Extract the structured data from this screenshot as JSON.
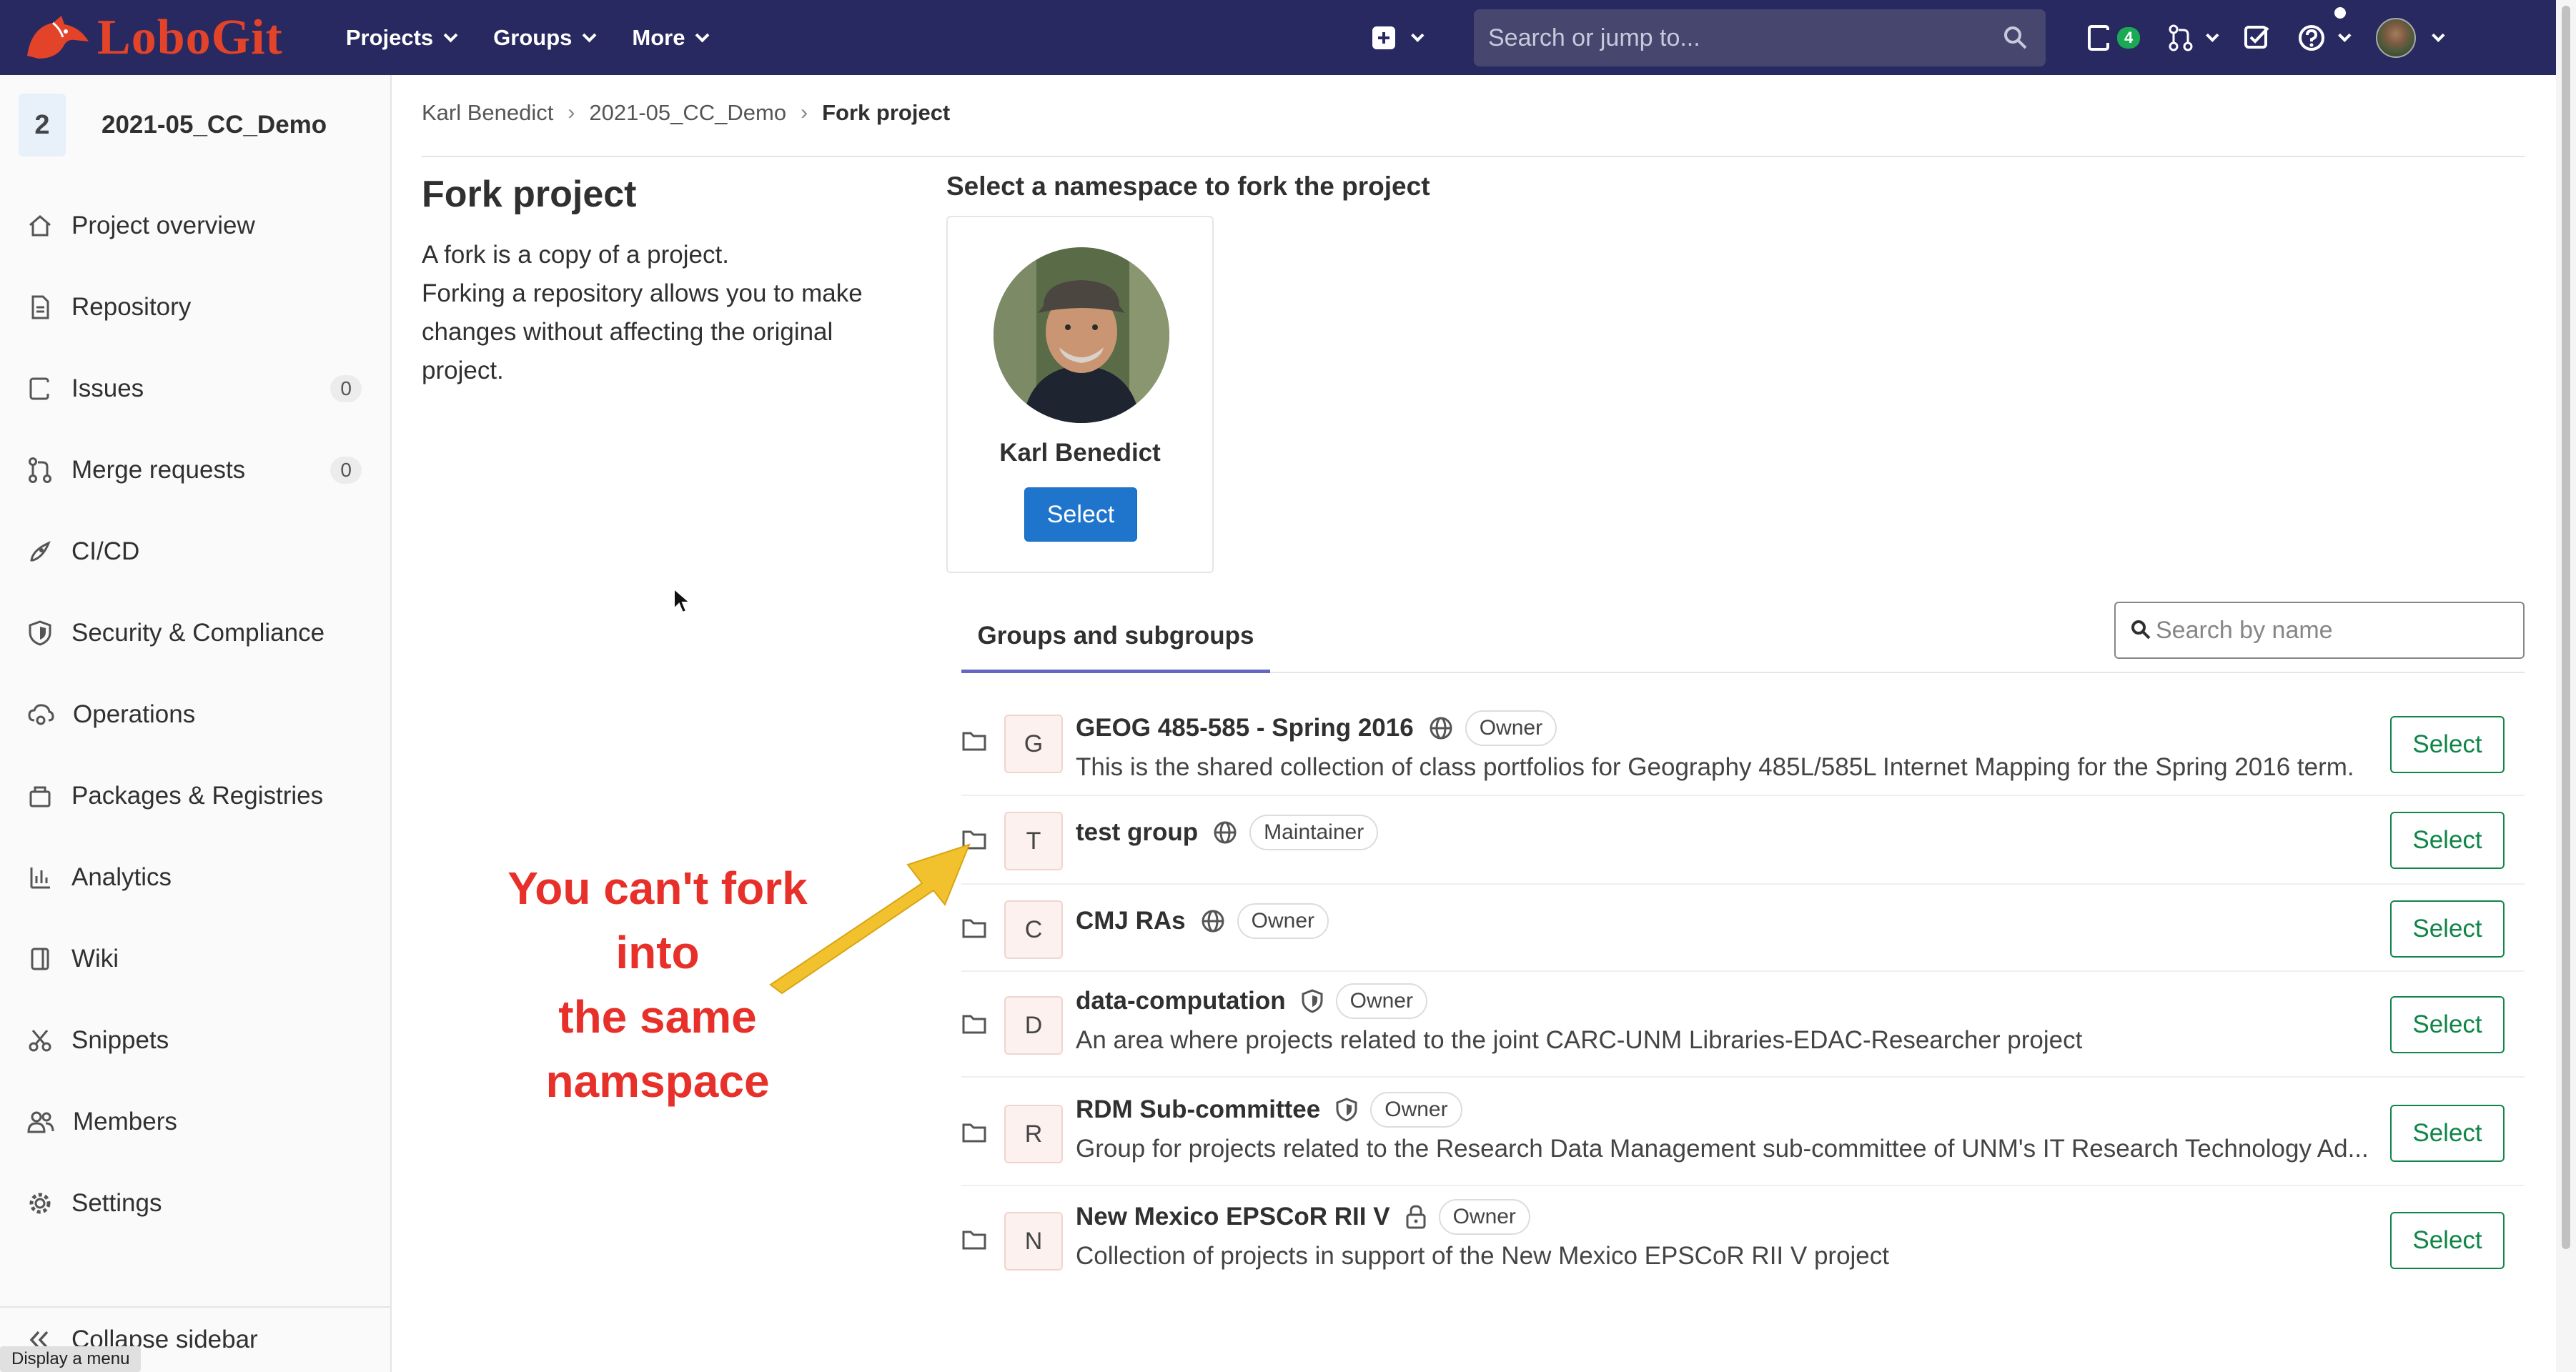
{
  "app": {
    "logo_text": "LoboGit",
    "brand_color": "#292961",
    "logo_color": "#e24329"
  },
  "navbar": {
    "menus": [
      {
        "label": "Projects"
      },
      {
        "label": "Groups"
      },
      {
        "label": "More"
      }
    ],
    "search_placeholder": "Search or jump to...",
    "issues_badge": "4"
  },
  "sidebar": {
    "project_avatar": "2",
    "project_name": "2021-05_CC_Demo",
    "items": [
      {
        "label": "Project overview",
        "icon": "home-icon"
      },
      {
        "label": "Repository",
        "icon": "document-icon"
      },
      {
        "label": "Issues",
        "icon": "issues-icon",
        "count": "0"
      },
      {
        "label": "Merge requests",
        "icon": "merge-request-icon",
        "count": "0"
      },
      {
        "label": "CI/CD",
        "icon": "rocket-icon"
      },
      {
        "label": "Security & Compliance",
        "icon": "shield-icon"
      },
      {
        "label": "Operations",
        "icon": "cloud-gear-icon"
      },
      {
        "label": "Packages & Registries",
        "icon": "package-icon"
      },
      {
        "label": "Analytics",
        "icon": "chart-icon"
      },
      {
        "label": "Wiki",
        "icon": "book-icon"
      },
      {
        "label": "Snippets",
        "icon": "scissors-icon"
      },
      {
        "label": "Members",
        "icon": "users-icon"
      },
      {
        "label": "Settings",
        "icon": "gear-icon"
      }
    ],
    "collapse_label": "Collapse sidebar",
    "tooltip": "Display a menu"
  },
  "breadcrumb": {
    "items": [
      "Karl Benedict",
      "2021-05_CC_Demo"
    ],
    "current": "Fork project"
  },
  "fork": {
    "title": "Fork project",
    "desc_line1": "A fork is a copy of a project.",
    "desc_line2": "Forking a repository allows you to make changes without affecting the original project.",
    "namespace_title": "Select a namespace to fork the project"
  },
  "user_card": {
    "name": "Karl Benedict",
    "select_label": "Select"
  },
  "groups_tab": {
    "label": "Groups and subgroups",
    "search_placeholder": "Search by name"
  },
  "groups": [
    {
      "avatar": "G",
      "name": "GEOG 485-585 - Spring 2016",
      "visibility": "globe-icon",
      "role": "Owner",
      "desc": "This is the shared collection of class portfolios for Geography 485L/585L Internet Mapping for the Spring 2016 term.",
      "select": "Select"
    },
    {
      "avatar": "T",
      "name": "test group",
      "visibility": "globe-icon",
      "role": "Maintainer",
      "desc": "",
      "select": "Select"
    },
    {
      "avatar": "C",
      "name": "CMJ RAs",
      "visibility": "globe-icon",
      "role": "Owner",
      "desc": "",
      "select": "Select"
    },
    {
      "avatar": "D",
      "name": "data-computation",
      "visibility": "shield-icon",
      "role": "Owner",
      "desc": "An area where projects related to the joint CARC-UNM Libraries-EDAC-Researcher project",
      "select": "Select"
    },
    {
      "avatar": "R",
      "name": "RDM Sub-committee",
      "visibility": "shield-icon",
      "role": "Owner",
      "desc": "Group for projects related to the Research Data Management sub-committee of UNM's IT Research Technology Ad...",
      "select": "Select"
    },
    {
      "avatar": "N",
      "name": "New Mexico EPSCoR RII V",
      "visibility": "lock-icon",
      "role": "Owner",
      "desc": "Collection of projects in support of the New Mexico EPSCoR RII V project",
      "select": "Select"
    }
  ],
  "annotation": {
    "line1": "You can't fork",
    "line2": "into",
    "line3": "the same",
    "line4": "namspace",
    "color": "#e8302a",
    "arrow_color": "#f2c12e"
  }
}
